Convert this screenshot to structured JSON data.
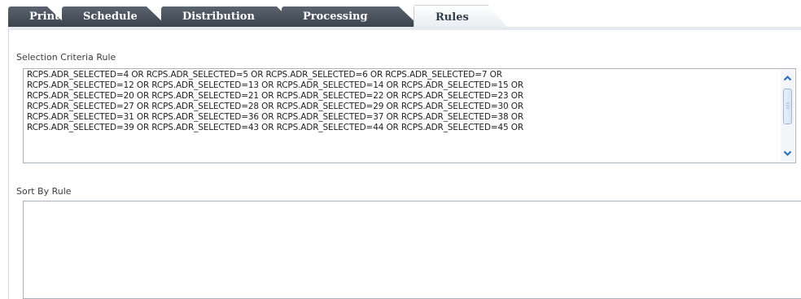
{
  "tabs": [
    {
      "label": "Print",
      "active": false
    },
    {
      "label": "Schedule",
      "active": false
    },
    {
      "label": "Distribution",
      "active": false
    },
    {
      "label": "Processing",
      "active": false
    },
    {
      "label": "Rules",
      "active": true
    }
  ],
  "selection": {
    "label": "Selection Criteria Rule",
    "lines": [
      "RCPS.ADR_SELECTED=4 OR RCPS.ADR_SELECTED=5 OR RCPS.ADR_SELECTED=6 OR RCPS.ADR_SELECTED=7 OR",
      "RCPS.ADR_SELECTED=12 OR RCPS.ADR_SELECTED=13 OR RCPS.ADR_SELECTED=14 OR RCPS.ADR_SELECTED=15 OR",
      "RCPS.ADR_SELECTED=20 OR RCPS.ADR_SELECTED=21 OR RCPS.ADR_SELECTED=22 OR RCPS.ADR_SELECTED=23 OR",
      "RCPS.ADR_SELECTED=27 OR RCPS.ADR_SELECTED=28 OR RCPS.ADR_SELECTED=29 OR RCPS.ADR_SELECTED=30 OR",
      "RCPS.ADR_SELECTED=31 OR RCPS.ADR_SELECTED=36 OR RCPS.ADR_SELECTED=37 OR RCPS.ADR_SELECTED=38 OR",
      "RCPS.ADR_SELECTED=39 OR RCPS.ADR_SELECTED=43 OR RCPS.ADR_SELECTED=44 OR RCPS.ADR_SELECTED=45 OR"
    ]
  },
  "sort": {
    "label": "Sort By Rule",
    "value": ""
  },
  "icons": {
    "scroll_up": "chevron-up-icon",
    "scroll_down": "chevron-down-icon"
  }
}
